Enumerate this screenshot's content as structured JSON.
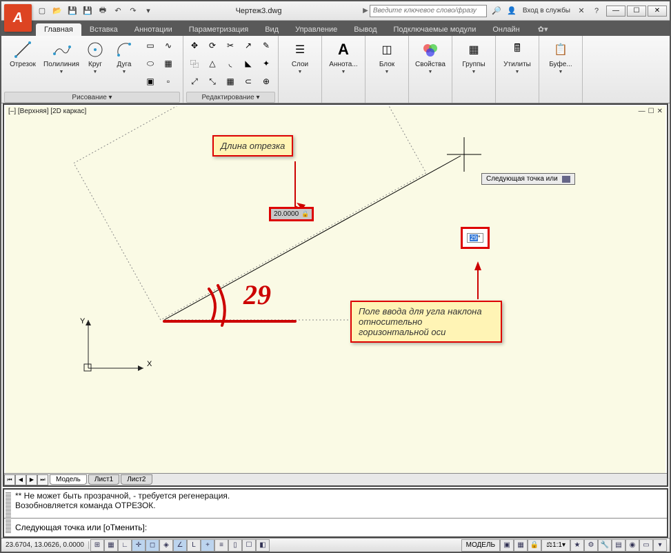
{
  "title": "Чертеж3.dwg",
  "search_placeholder": "Введите ключевое слово/фразу",
  "login_label": "Вход в службы",
  "tabs": {
    "home": "Главная",
    "insert": "Вставка",
    "annotate": "Аннотации",
    "parametric": "Параметризация",
    "view": "Вид",
    "manage": "Управление",
    "output": "Вывод",
    "plugins": "Подключаемые модули",
    "online": "Онлайн"
  },
  "ribbon": {
    "line": "Отрезок",
    "polyline": "Полилиния",
    "circle": "Круг",
    "arc": "Дуга",
    "layers": "Слои",
    "annotate": "Аннота...",
    "block": "Блок",
    "properties": "Свойства",
    "groups": "Группы",
    "utilities": "Утилиты",
    "clipboard": "Буфе...",
    "panel_draw": "Рисование ▾",
    "panel_modify": "Редактирование ▾"
  },
  "viewport_label": "[–] [Верхняя] [2D каркас]",
  "callout_length": "Длина отрезка",
  "callout_angle": "Поле ввода для угла наклона относительно горизонтальной оси",
  "dyn_length": "20.0000",
  "dyn_angle": "29",
  "dyn_angle_deg": "°",
  "tooltip_next": "Следующая точка или",
  "handdrawn_angle": "29",
  "axis_x": "X",
  "axis_y": "Y",
  "sheets": {
    "model": "Модель",
    "sheet1": "Лист1",
    "sheet2": "Лист2"
  },
  "cmd_hist1": "** Не может быть прозрачной, - требуется регенерация.",
  "cmd_hist2": "Возобновляется команда ОТРЕЗОК.",
  "cmd_prompt": "Следующая точка или [оТменить]:",
  "status": {
    "coords": "23.6704, 13.0626, 0.0000",
    "model": "МОДЕЛЬ",
    "scale": "1:1"
  }
}
